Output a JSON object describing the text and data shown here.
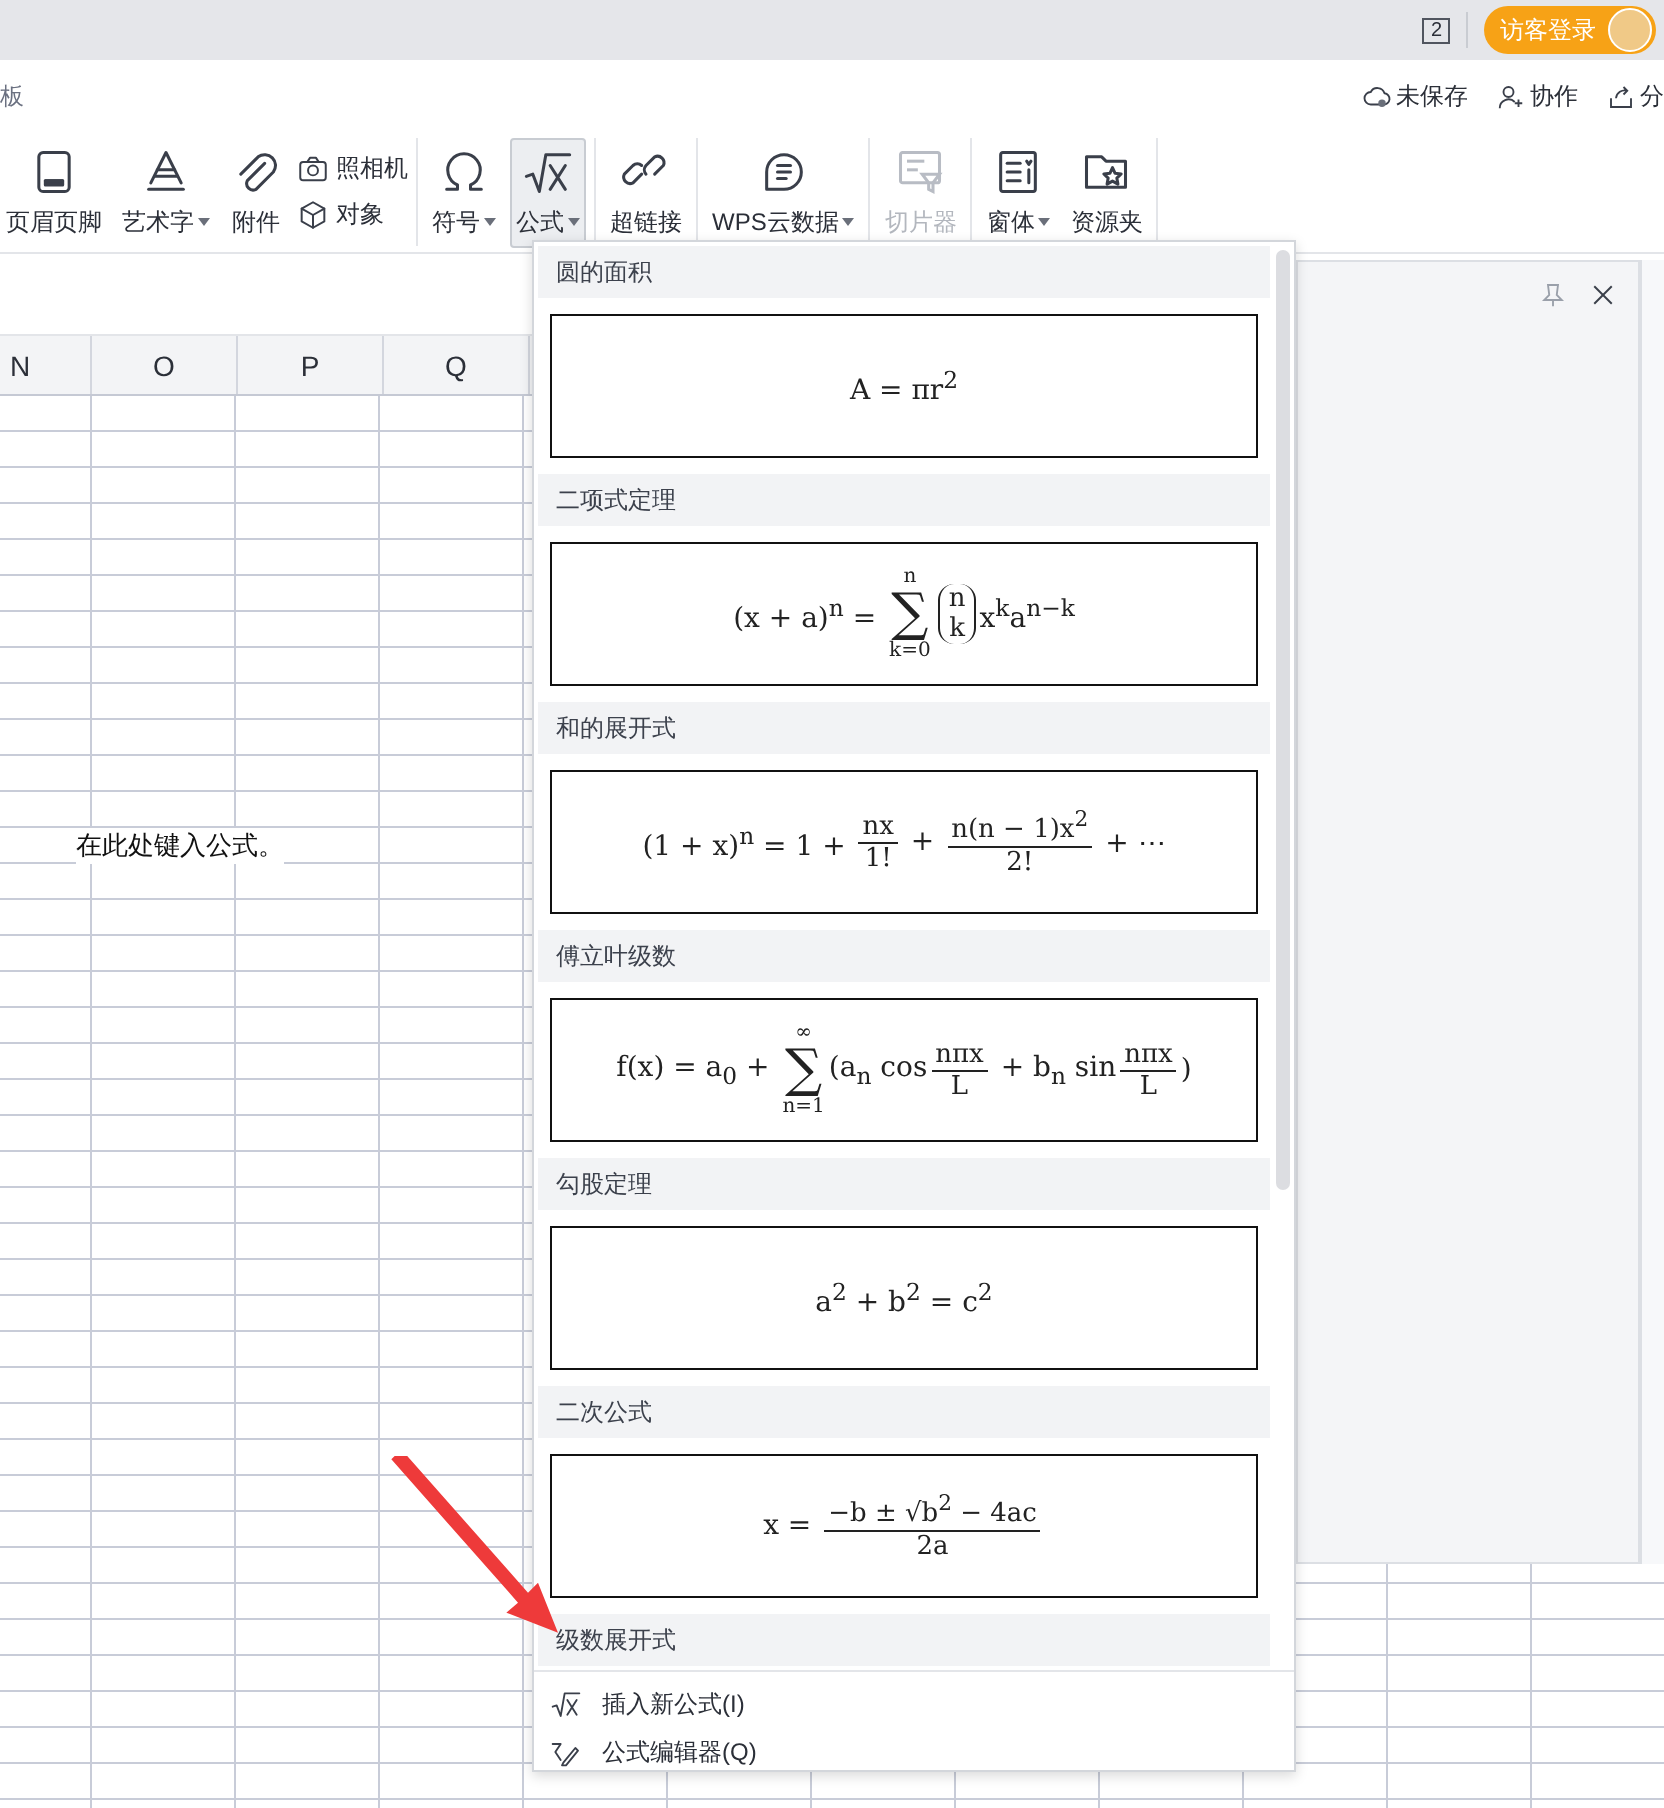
{
  "title_bar": {
    "window_count": "2",
    "login_button": "访客登录"
  },
  "ribbon_header": {
    "tab_partial": "板",
    "actions": [
      {
        "label": "未保存"
      },
      {
        "label": "协作"
      },
      {
        "label": "分"
      }
    ]
  },
  "toolbar": {
    "groups": [
      {
        "items": [
          {
            "kind": "large",
            "label": "页眉页脚",
            "dropdown": false,
            "disabled": false,
            "selected": false
          },
          {
            "kind": "large",
            "label": "艺术字",
            "dropdown": true,
            "disabled": false,
            "selected": false
          },
          {
            "kind": "large",
            "label": "附件",
            "dropdown": false,
            "disabled": false,
            "selected": false
          },
          {
            "kind": "stack",
            "items": [
              {
                "label": "照相机"
              },
              {
                "label": "对象"
              }
            ]
          }
        ]
      },
      {
        "items": [
          {
            "kind": "large",
            "label": "符号",
            "dropdown": true,
            "disabled": false,
            "selected": false
          },
          {
            "kind": "large",
            "label": "公式",
            "dropdown": true,
            "disabled": false,
            "selected": true
          }
        ]
      },
      {
        "items": [
          {
            "kind": "large",
            "label": "超链接",
            "dropdown": false,
            "disabled": false,
            "selected": false
          }
        ]
      },
      {
        "items": [
          {
            "kind": "large",
            "label": "WPS云数据",
            "dropdown": true,
            "disabled": false,
            "selected": false
          }
        ]
      },
      {
        "items": [
          {
            "kind": "large",
            "label": "切片器",
            "dropdown": false,
            "disabled": true,
            "selected": false
          }
        ]
      },
      {
        "items": [
          {
            "kind": "large",
            "label": "窗体",
            "dropdown": true,
            "disabled": false,
            "selected": false
          },
          {
            "kind": "large",
            "label": "资源夹",
            "dropdown": false,
            "disabled": false,
            "selected": false
          }
        ]
      }
    ]
  },
  "sheet": {
    "columns": [
      "N",
      "O",
      "P",
      "Q"
    ],
    "note": "在此处键入公式。"
  },
  "formula_menu": {
    "sections": [
      {
        "title": "圆的面积",
        "formula": [
          {
            "kind": "text",
            "text": "A = πr$^{2}$"
          }
        ]
      },
      {
        "title": "二项式定理",
        "formula": [
          {
            "kind": "text",
            "text": "(x + a)$^{n}$ = "
          },
          {
            "kind": "sum",
            "symbol": "∑",
            "top": "n",
            "bottom": "k=0"
          },
          {
            "kind": "binom",
            "top": "n",
            "bottom": "k"
          },
          {
            "kind": "text",
            "text": "x$^{k}$a$^{n−k}$"
          }
        ]
      },
      {
        "title": "和的展开式",
        "formula": [
          {
            "kind": "text",
            "text": "(1 + x)$^{n}$ = 1 + "
          },
          {
            "kind": "frac",
            "num": "nx",
            "den": "1!"
          },
          {
            "kind": "text",
            "text": " + "
          },
          {
            "kind": "frac",
            "num": "n(n − 1)x$^{2}$",
            "den": "2!"
          },
          {
            "kind": "text",
            "text": " + ⋯"
          }
        ]
      },
      {
        "title": "傅立叶级数",
        "formula": [
          {
            "kind": "text",
            "text": "f(x) = a$_{0}$ + "
          },
          {
            "kind": "sum",
            "symbol": "∑",
            "top": "∞",
            "bottom": "n=1"
          },
          {
            "kind": "text",
            "text": "(a$_{n}$ cos"
          },
          {
            "kind": "frac",
            "num": "nπx",
            "den": "L"
          },
          {
            "kind": "text",
            "text": " + b$_{n}$ sin"
          },
          {
            "kind": "frac",
            "num": "nπx",
            "den": "L"
          },
          {
            "kind": "text",
            "text": ")"
          }
        ]
      },
      {
        "title": "勾股定理",
        "formula": [
          {
            "kind": "text",
            "text": "a$^{2}$ + b$^{2}$ = c$^{2}$"
          }
        ]
      },
      {
        "title": "二次公式",
        "formula": [
          {
            "kind": "text",
            "text": "x = "
          },
          {
            "kind": "frac",
            "num": "−b ± √b$^{2}$ − 4ac",
            "den": "2a"
          }
        ]
      },
      {
        "title": "级数展开式"
      }
    ],
    "footer": [
      {
        "label": "插入新公式(I)"
      },
      {
        "label": "公式编辑器(Q)"
      }
    ]
  }
}
